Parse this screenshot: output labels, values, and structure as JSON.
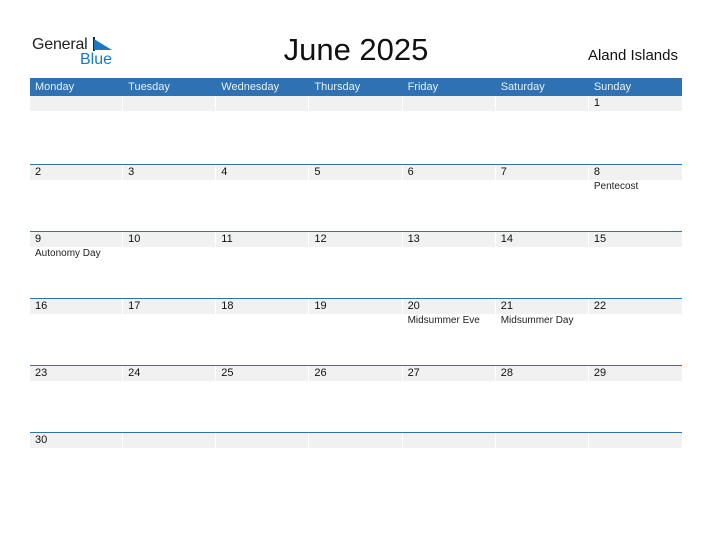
{
  "logo": {
    "part1": "General",
    "part2": "Blue"
  },
  "title": "June 2025",
  "region": "Aland Islands",
  "colors": {
    "accent": "#2e72b4",
    "date_strip": "#f1f1f1",
    "logo_blue": "#1a78c2"
  },
  "weekdays": [
    "Monday",
    "Tuesday",
    "Wednesday",
    "Thursday",
    "Friday",
    "Saturday",
    "Sunday"
  ],
  "weeks": [
    {
      "days": [
        {
          "d": "",
          "h": ""
        },
        {
          "d": "",
          "h": ""
        },
        {
          "d": "",
          "h": ""
        },
        {
          "d": "",
          "h": ""
        },
        {
          "d": "",
          "h": ""
        },
        {
          "d": "",
          "h": ""
        },
        {
          "d": "1",
          "h": ""
        }
      ]
    },
    {
      "days": [
        {
          "d": "2",
          "h": ""
        },
        {
          "d": "3",
          "h": ""
        },
        {
          "d": "4",
          "h": ""
        },
        {
          "d": "5",
          "h": ""
        },
        {
          "d": "6",
          "h": ""
        },
        {
          "d": "7",
          "h": ""
        },
        {
          "d": "8",
          "h": "Pentecost"
        }
      ]
    },
    {
      "days": [
        {
          "d": "9",
          "h": "Autonomy Day"
        },
        {
          "d": "10",
          "h": ""
        },
        {
          "d": "11",
          "h": ""
        },
        {
          "d": "12",
          "h": ""
        },
        {
          "d": "13",
          "h": ""
        },
        {
          "d": "14",
          "h": ""
        },
        {
          "d": "15",
          "h": ""
        }
      ]
    },
    {
      "days": [
        {
          "d": "16",
          "h": ""
        },
        {
          "d": "17",
          "h": ""
        },
        {
          "d": "18",
          "h": ""
        },
        {
          "d": "19",
          "h": ""
        },
        {
          "d": "20",
          "h": "Midsummer Eve"
        },
        {
          "d": "21",
          "h": "Midsummer Day"
        },
        {
          "d": "22",
          "h": ""
        }
      ]
    },
    {
      "days": [
        {
          "d": "23",
          "h": ""
        },
        {
          "d": "24",
          "h": ""
        },
        {
          "d": "25",
          "h": ""
        },
        {
          "d": "26",
          "h": ""
        },
        {
          "d": "27",
          "h": ""
        },
        {
          "d": "28",
          "h": ""
        },
        {
          "d": "29",
          "h": ""
        }
      ]
    },
    {
      "days": [
        {
          "d": "30",
          "h": ""
        },
        {
          "d": "",
          "h": ""
        },
        {
          "d": "",
          "h": ""
        },
        {
          "d": "",
          "h": ""
        },
        {
          "d": "",
          "h": ""
        },
        {
          "d": "",
          "h": ""
        },
        {
          "d": "",
          "h": ""
        }
      ]
    }
  ]
}
